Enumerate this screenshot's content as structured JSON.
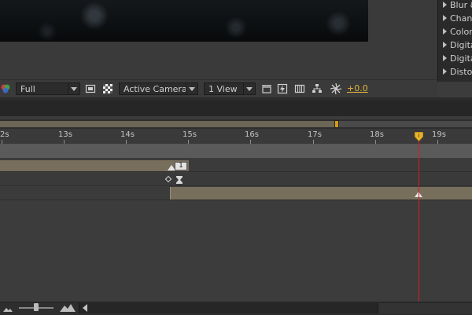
{
  "effects": {
    "items": [
      {
        "label": "Blur &"
      },
      {
        "label": "Chann"
      },
      {
        "label": "Color"
      },
      {
        "label": "Digita"
      },
      {
        "label": "Digita"
      },
      {
        "label": "Distor"
      }
    ]
  },
  "viewer_toolbar": {
    "resolution": "Full",
    "camera": "Active Camera",
    "views": "1 View",
    "exposure": "+0.0"
  },
  "timeline": {
    "ruler_labels": [
      "2s",
      "13s",
      "14s",
      "15s",
      "16s",
      "17s",
      "18s",
      "19s"
    ],
    "layer_marker_label": "1"
  },
  "colors": {
    "accent": "#e1b43a",
    "playhead": "#d31f1f",
    "layer_bar": "#786e5c"
  }
}
